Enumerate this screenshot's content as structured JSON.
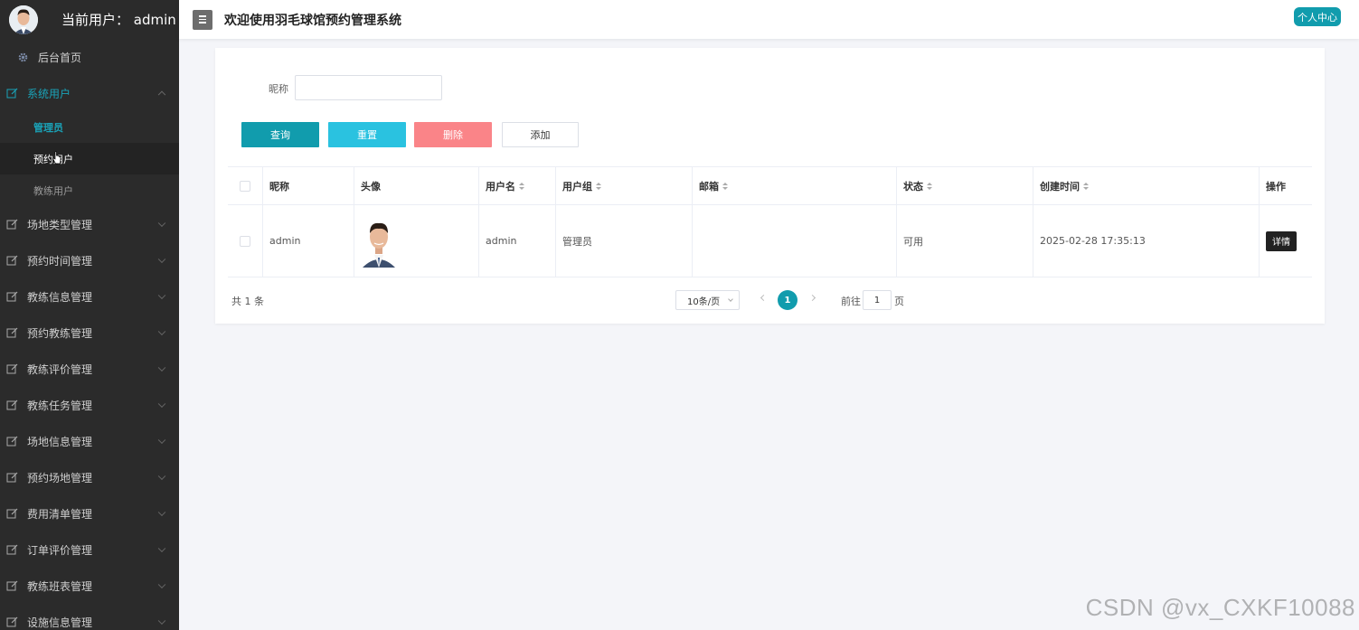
{
  "sidebar": {
    "current_user_label": "当前用户： admin",
    "home": "后台首页",
    "groups": [
      {
        "label": "系统用户",
        "expanded": true,
        "children": [
          "管理员",
          "预约用户",
          "教练用户"
        ]
      },
      {
        "label": "场地类型管理"
      },
      {
        "label": "预约时间管理"
      },
      {
        "label": "教练信息管理"
      },
      {
        "label": "预约教练管理"
      },
      {
        "label": "教练评价管理"
      },
      {
        "label": "教练任务管理"
      },
      {
        "label": "场地信息管理"
      },
      {
        "label": "预约场地管理"
      },
      {
        "label": "费用清单管理"
      },
      {
        "label": "订单评价管理"
      },
      {
        "label": "教练班表管理"
      },
      {
        "label": "设施信息管理"
      }
    ]
  },
  "header": {
    "title": "欢迎使用羽毛球馆预约管理系统",
    "profile_button": "个人中心"
  },
  "search": {
    "nickname_label": "昵称",
    "nickname_value": ""
  },
  "actions": {
    "query": "查询",
    "reset": "重置",
    "delete": "删除",
    "add": "添加"
  },
  "table": {
    "columns": [
      "昵称",
      "头像",
      "用户名",
      "用户组",
      "邮箱",
      "状态",
      "创建时间",
      "操作"
    ],
    "rows": [
      {
        "nickname": "admin",
        "username": "admin",
        "group": "管理员",
        "email": "",
        "status": "可用",
        "created": "2025-02-28 17:35:13",
        "action": "详情"
      }
    ]
  },
  "pagination": {
    "total": "共 1 条",
    "page_size": "10条/页",
    "current_page": "1",
    "goto_label": "前往",
    "goto_value": "1",
    "page_unit": "页"
  },
  "watermark": "CSDN @vx_CXKF10088",
  "colors": {
    "sidebar_bg": "#2b2b2b",
    "accent": "#119cad",
    "reset": "#2ac2e0",
    "delete": "#fa8488"
  }
}
